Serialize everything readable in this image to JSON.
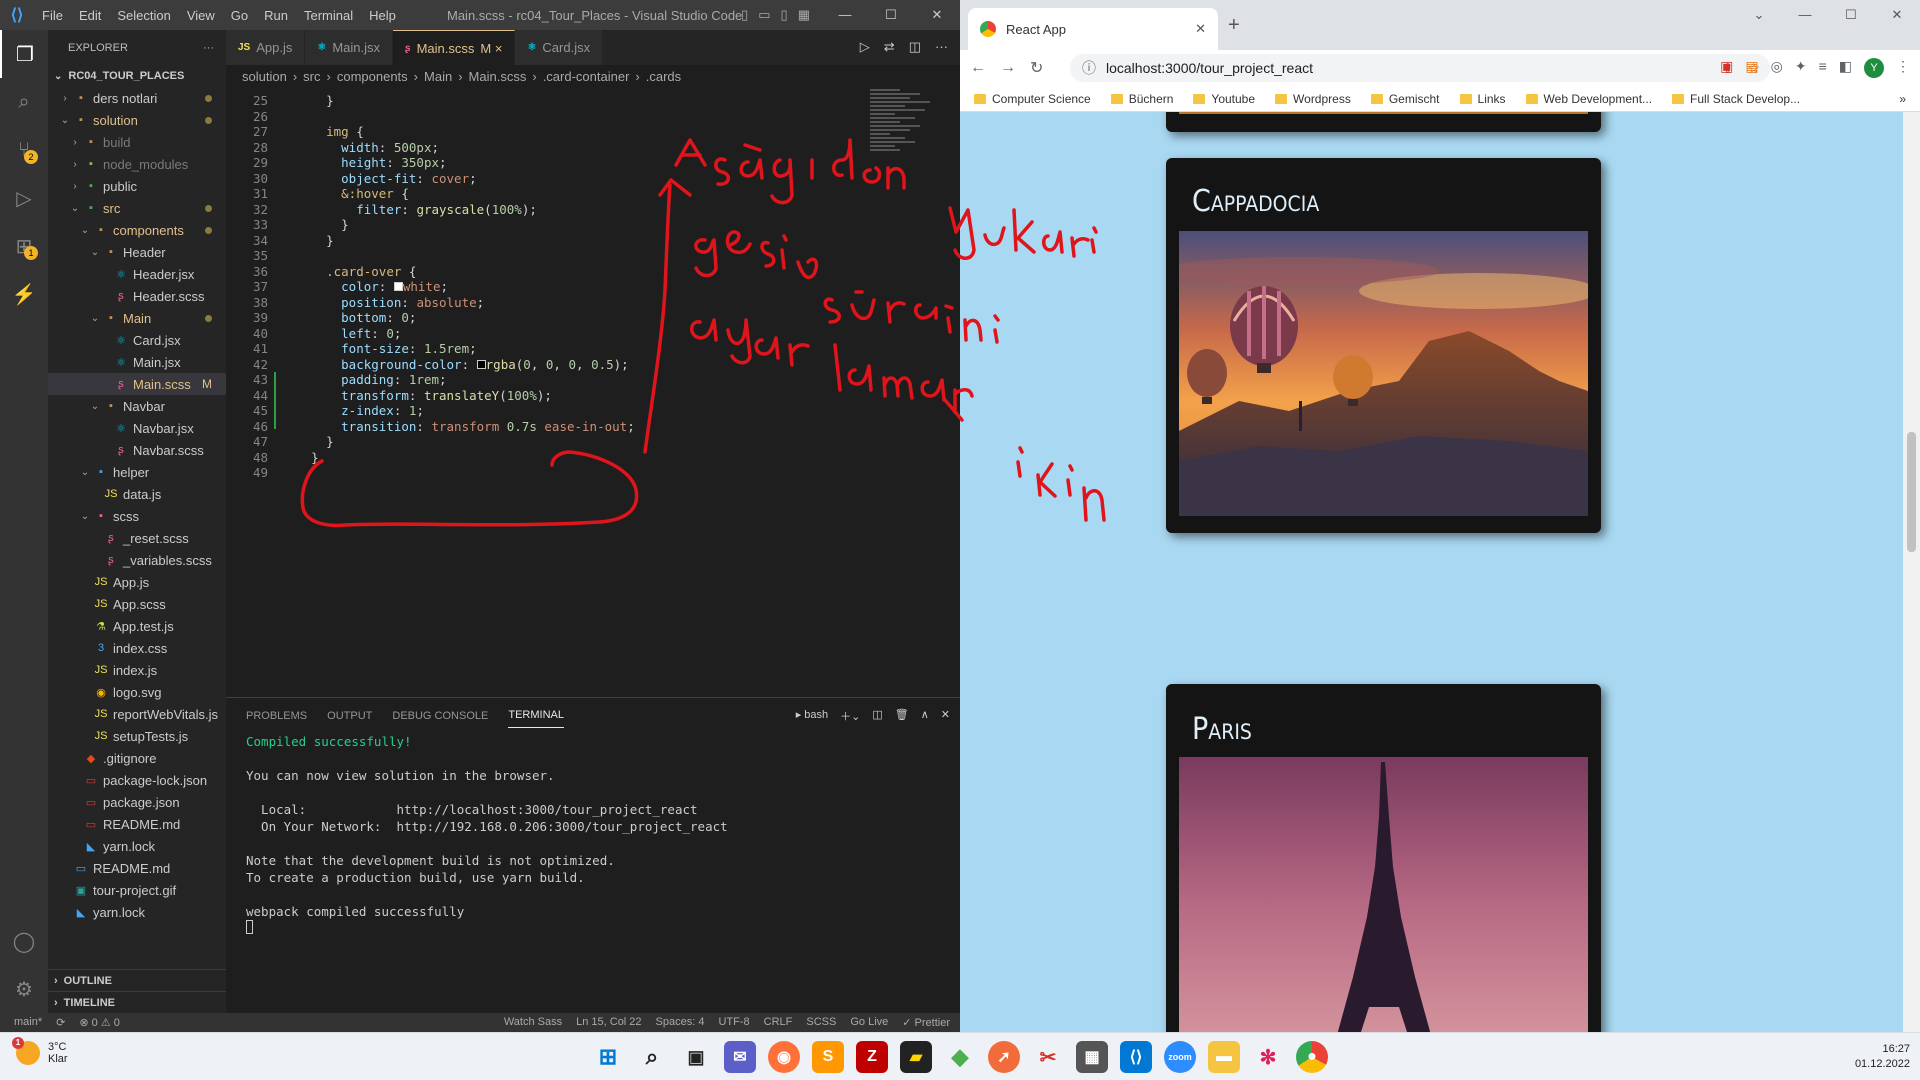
{
  "vscode": {
    "menu": [
      "File",
      "Edit",
      "Selection",
      "View",
      "Go",
      "Run",
      "Terminal",
      "Help"
    ],
    "window_title": "Main.scss - rc04_Tour_Places - Visual Studio Code",
    "explorer_title": "EXPLORER",
    "explorer_more": "···",
    "root_folder": "RC04_TOUR_PLACES",
    "tree": [
      {
        "label": "ders notlari",
        "depth": 1,
        "chev": "›",
        "icon": "▪",
        "color": "#c09553",
        "dot": true
      },
      {
        "label": "solution",
        "depth": 1,
        "chev": "⌄",
        "icon": "▪",
        "color": "#c09553",
        "dot": true,
        "gold": true
      },
      {
        "label": "build",
        "depth": 2,
        "chev": "›",
        "icon": "▪",
        "color": "#c09553",
        "dim": true
      },
      {
        "label": "node_modules",
        "depth": 2,
        "chev": "›",
        "icon": "▪",
        "color": "#8bc34a",
        "dim": true
      },
      {
        "label": "public",
        "depth": 2,
        "chev": "›",
        "icon": "▪",
        "color": "#4caf50"
      },
      {
        "label": "src",
        "depth": 2,
        "chev": "⌄",
        "icon": "▪",
        "color": "#4caf50",
        "dot": true,
        "gold": true
      },
      {
        "label": "components",
        "depth": 3,
        "chev": "⌄",
        "icon": "▪",
        "color": "#c09553",
        "dot": true,
        "gold": true
      },
      {
        "label": "Header",
        "depth": 4,
        "chev": "⌄",
        "icon": "▪",
        "color": "#c09553"
      },
      {
        "label": "Header.jsx",
        "depth": 5,
        "chev": "",
        "icon": "⚛",
        "color": "#00bcd4"
      },
      {
        "label": "Header.scss",
        "depth": 5,
        "chev": "",
        "icon": "ʂ",
        "color": "#f06292"
      },
      {
        "label": "Main",
        "depth": 4,
        "chev": "⌄",
        "icon": "▪",
        "color": "#c09553",
        "dot": true,
        "gold": true
      },
      {
        "label": "Card.jsx",
        "depth": 5,
        "chev": "",
        "icon": "⚛",
        "color": "#00bcd4"
      },
      {
        "label": "Main.jsx",
        "depth": 5,
        "chev": "",
        "icon": "⚛",
        "color": "#00bcd4"
      },
      {
        "label": "Main.scss",
        "depth": 5,
        "chev": "",
        "icon": "ʂ",
        "color": "#f06292",
        "mod": "M",
        "gold": true,
        "sel": true
      },
      {
        "label": "Navbar",
        "depth": 4,
        "chev": "⌄",
        "icon": "▪",
        "color": "#c09553"
      },
      {
        "label": "Navbar.jsx",
        "depth": 5,
        "chev": "",
        "icon": "⚛",
        "color": "#00bcd4"
      },
      {
        "label": "Navbar.scss",
        "depth": 5,
        "chev": "",
        "icon": "ʂ",
        "color": "#f06292"
      },
      {
        "label": "helper",
        "depth": 3,
        "chev": "⌄",
        "icon": "▪",
        "color": "#42a5f5"
      },
      {
        "label": "data.js",
        "depth": 4,
        "chev": "",
        "icon": "JS",
        "color": "#f1e05a"
      },
      {
        "label": "scss",
        "depth": 3,
        "chev": "⌄",
        "icon": "▪",
        "color": "#f06292"
      },
      {
        "label": "_reset.scss",
        "depth": 4,
        "chev": "",
        "icon": "ʂ",
        "color": "#f06292"
      },
      {
        "label": "_variables.scss",
        "depth": 4,
        "chev": "",
        "icon": "ʂ",
        "color": "#f06292"
      },
      {
        "label": "App.js",
        "depth": 3,
        "chev": "",
        "icon": "JS",
        "color": "#f1e05a"
      },
      {
        "label": "App.scss",
        "depth": 3,
        "chev": "",
        "icon": "JS",
        "color": "#f1e05a"
      },
      {
        "label": "App.test.js",
        "depth": 3,
        "chev": "",
        "icon": "⚗",
        "color": "#cddc39"
      },
      {
        "label": "index.css",
        "depth": 3,
        "chev": "",
        "icon": "3",
        "color": "#42a5f5"
      },
      {
        "label": "index.js",
        "depth": 3,
        "chev": "",
        "icon": "JS",
        "color": "#f1e05a"
      },
      {
        "label": "logo.svg",
        "depth": 3,
        "chev": "",
        "icon": "◉",
        "color": "#ffb300"
      },
      {
        "label": "reportWebVitals.js",
        "depth": 3,
        "chev": "",
        "icon": "JS",
        "color": "#f1e05a"
      },
      {
        "label": "setupTests.js",
        "depth": 3,
        "chev": "",
        "icon": "JS",
        "color": "#f1e05a"
      },
      {
        "label": ".gitignore",
        "depth": 2,
        "chev": "",
        "icon": "◆",
        "color": "#e64a19"
      },
      {
        "label": "package-lock.json",
        "depth": 2,
        "chev": "",
        "icon": "▭",
        "color": "#e53935"
      },
      {
        "label": "package.json",
        "depth": 2,
        "chev": "",
        "icon": "▭",
        "color": "#e53935"
      },
      {
        "label": "README.md",
        "depth": 2,
        "chev": "",
        "icon": "▭",
        "color": "#e53935"
      },
      {
        "label": "yarn.lock",
        "depth": 2,
        "chev": "",
        "icon": "◣",
        "color": "#42a5f5"
      },
      {
        "label": "README.md",
        "depth": 1,
        "chev": "",
        "icon": "▭",
        "color": "#42a5f5"
      },
      {
        "label": "tour-project.gif",
        "depth": 1,
        "chev": "",
        "icon": "▣",
        "color": "#26a69a"
      },
      {
        "label": "yarn.lock",
        "depth": 1,
        "chev": "",
        "icon": "◣",
        "color": "#42a5f5"
      }
    ],
    "outline_label": "OUTLINE",
    "timeline_label": "TIMELINE",
    "tabs": [
      {
        "label": "App.js",
        "icon": "JS",
        "icon_color": "#f1e05a",
        "active": false,
        "suffix": ""
      },
      {
        "label": "Main.jsx",
        "icon": "⚛",
        "icon_color": "#00bcd4",
        "active": false,
        "suffix": ""
      },
      {
        "label": "Main.scss",
        "icon": "ʂ",
        "icon_color": "#f06292",
        "active": true,
        "suffix": "M ×"
      },
      {
        "label": "Card.jsx",
        "icon": "⚛",
        "icon_color": "#00bcd4",
        "active": false,
        "suffix": ""
      }
    ],
    "breadcrumb": [
      "solution",
      "src",
      "components",
      "Main",
      "Main.scss",
      ".card-container",
      ".cards"
    ],
    "code_lines": [
      {
        "n": "25",
        "html": "    <span class=\"o\">}</span>"
      },
      {
        "n": "26",
        "html": ""
      },
      {
        "n": "27",
        "html": "    <span class=\"k\">img</span> <span class=\"o\">{</span>"
      },
      {
        "n": "28",
        "html": "      <span class=\"p\">width</span><span class=\"o\">: </span><span class=\"n\">500px</span><span class=\"o\">;</span>"
      },
      {
        "n": "29",
        "html": "      <span class=\"p\">height</span><span class=\"o\">: </span><span class=\"n\">350px</span><span class=\"o\">;</span>"
      },
      {
        "n": "30",
        "html": "      <span class=\"p\">object-fit</span><span class=\"o\">: </span><span class=\"v\">cover</span><span class=\"o\">;</span>"
      },
      {
        "n": "31",
        "html": "      <span class=\"k\">&amp;:hover</span> <span class=\"o\">{</span>"
      },
      {
        "n": "32",
        "html": "        <span class=\"p\">filter</span><span class=\"o\">: </span><span class=\"fn\">grayscale</span><span class=\"o\">(</span><span class=\"n\">100%</span><span class=\"o\">);</span>"
      },
      {
        "n": "33",
        "html": "      <span class=\"o\">}</span>"
      },
      {
        "n": "34",
        "html": "    <span class=\"o\">}</span>"
      },
      {
        "n": "35",
        "html": ""
      },
      {
        "n": "36",
        "html": "    <span class=\"k\">.card-over</span> <span class=\"o\">{</span>"
      },
      {
        "n": "37",
        "html": "      <span class=\"p\">color</span><span class=\"o\">: </span><span style=\"display:inline-block;width:9px;height:9px;background:#fff;border:1px solid #ccc\"></span><span class=\"v\">white</span><span class=\"o\">;</span>"
      },
      {
        "n": "38",
        "html": "      <span class=\"p\">position</span><span class=\"o\">: </span><span class=\"v\">absolute</span><span class=\"o\">;</span>"
      },
      {
        "n": "39",
        "html": "      <span class=\"p\">bottom</span><span class=\"o\">: </span><span class=\"n\">0</span><span class=\"o\">;</span>"
      },
      {
        "n": "40",
        "html": "      <span class=\"p\">left</span><span class=\"o\">: </span><span class=\"n\">0</span><span class=\"o\">;</span>"
      },
      {
        "n": "41",
        "html": "      <span class=\"p\">font-size</span><span class=\"o\">: </span><span class=\"n\">1.5rem</span><span class=\"o\">;</span>"
      },
      {
        "n": "42",
        "html": "      <span class=\"p\">background-color</span><span class=\"o\">: </span><span style=\"display:inline-block;width:9px;height:9px;background:#000;border:1px solid #ccc\"></span><span class=\"fn\">rgba</span><span class=\"o\">(</span><span class=\"n\">0</span><span class=\"o\">, </span><span class=\"n\">0</span><span class=\"o\">, </span><span class=\"n\">0</span><span class=\"o\">, </span><span class=\"n\">0.5</span><span class=\"o\">);</span>"
      },
      {
        "n": "43",
        "html": "      <span class=\"p\">padding</span><span class=\"o\">: </span><span class=\"n\">1rem</span><span class=\"o\">;</span>"
      },
      {
        "n": "44",
        "html": "      <span class=\"p\">transform</span><span class=\"o\">: </span><span class=\"fn\">translateY</span><span class=\"o\">(</span><span class=\"n\">100%</span><span class=\"o\">);</span>"
      },
      {
        "n": "45",
        "html": "      <span class=\"p\">z-index</span><span class=\"o\">: </span><span class=\"n\">1</span><span class=\"o\">;</span>"
      },
      {
        "n": "46",
        "html": "      <span class=\"p\">transition</span><span class=\"o\">: </span><span class=\"v\">transform</span> <span class=\"n\">0.7s</span> <span class=\"v\">ease-in-out</span><span class=\"o\">;</span>"
      },
      {
        "n": "47",
        "html": "    <span class=\"o\">}</span>"
      },
      {
        "n": "48",
        "html": "  <span class=\"o\">}</span>"
      },
      {
        "n": "49",
        "html": ""
      }
    ],
    "panel_tabs": [
      "PROBLEMS",
      "OUTPUT",
      "DEBUG CONSOLE",
      "TERMINAL"
    ],
    "panel_active_tab": "TERMINAL",
    "terminal_shell": "bash",
    "terminal_lines": [
      {
        "text": "Compiled successfully!",
        "color": "#23d18b"
      },
      {
        "text": "",
        "color": "#ccc"
      },
      {
        "text": "You can now view solution in the browser.",
        "color": "#ccc"
      },
      {
        "text": "",
        "color": "#ccc"
      },
      {
        "text": "  Local:            http://localhost:3000/tour_project_react",
        "color": "#ccc"
      },
      {
        "text": "  On Your Network:  http://192.168.0.206:3000/tour_project_react",
        "color": "#ccc"
      },
      {
        "text": "",
        "color": "#ccc"
      },
      {
        "text": "Note that the development build is not optimized.",
        "color": "#ccc"
      },
      {
        "text": "To create a production build, use yarn build.",
        "color": "#ccc"
      },
      {
        "text": "",
        "color": "#ccc"
      },
      {
        "text": "webpack compiled successfully",
        "color": "#ccc"
      }
    ],
    "status_left": [
      "main*",
      "⟳",
      "⊗ 0 ⚠ 0"
    ],
    "status_right": [
      "Watch Sass",
      "Ln 15, Col 22",
      "Spaces: 4",
      "UTF-8",
      "CRLF",
      "SCSS",
      "Go Live",
      "✓ Prettier"
    ]
  },
  "chrome": {
    "tab_title": "React App",
    "url": "localhost:3000/tour_project_react",
    "bookmarks": [
      "Computer Science",
      "Büchern",
      "Youtube",
      "Wordpress",
      "Gemischt",
      "Links",
      "Web Development...",
      "Full Stack Develop..."
    ],
    "profile_initial": "Y",
    "cards": [
      {
        "title": "Cappadocia"
      },
      {
        "title": "Paris"
      }
    ]
  },
  "annotation": {
    "words": [
      "Aşağıdan",
      "yukarı",
      "geçiş",
      "sürecini",
      "ayarlamak",
      "için"
    ],
    "color": "#e0141b"
  },
  "taskbar": {
    "temperature": "3°C",
    "weather": "Klar",
    "time": "16:27",
    "date": "01.12.2022"
  }
}
